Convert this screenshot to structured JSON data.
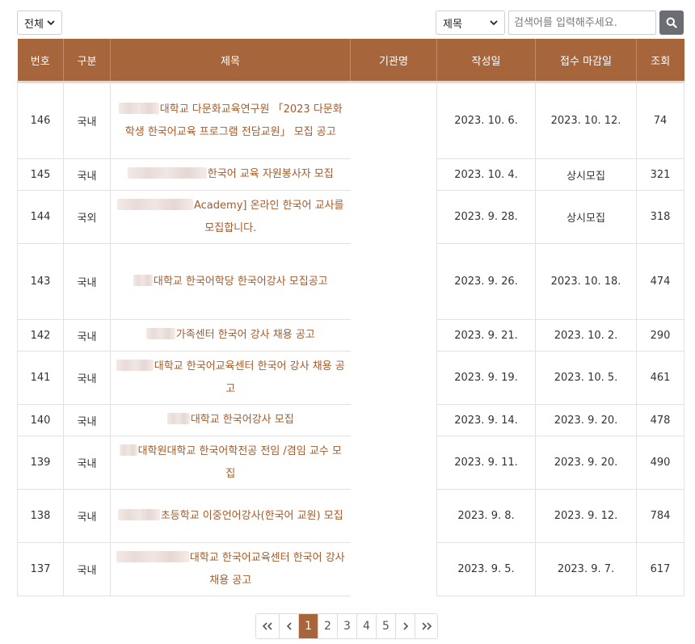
{
  "filters": {
    "category_selected": "전체",
    "field_selected": "제목",
    "search_placeholder": "검색어를 입력해주세요."
  },
  "table": {
    "headers": [
      "번호",
      "구분",
      "제목",
      "기관명",
      "작성일",
      "접수 마감일",
      "조회"
    ],
    "rows": [
      {
        "no": "146",
        "type": "국내",
        "title": "대학교 다문화교육연구원 「2023 다문화학생 한국어교육 프로그램 전담교원」 모집 공고",
        "date": "2023. 10. 6.",
        "deadline": "2023. 10. 12.",
        "views": "74"
      },
      {
        "no": "145",
        "type": "국내",
        "title": "한국어 교육 자원봉사자 모집",
        "date": "2023. 10. 4.",
        "deadline": "상시모집",
        "views": "321"
      },
      {
        "no": "144",
        "type": "국외",
        "title": "Academy] 온라인 한국어 교사를 모집합니다.",
        "date": "2023. 9. 28.",
        "deadline": "상시모집",
        "views": "318"
      },
      {
        "no": "143",
        "type": "국내",
        "title": "대학교 한국어학당 한국어강사 모집공고",
        "date": "2023. 9. 26.",
        "deadline": "2023. 10. 18.",
        "views": "474"
      },
      {
        "no": "142",
        "type": "국내",
        "title": "가족센터 한국어 강사 채용 공고",
        "date": "2023. 9. 21.",
        "deadline": "2023. 10. 2.",
        "views": "290"
      },
      {
        "no": "141",
        "type": "국내",
        "title": "대학교 한국어교육센터 한국어 강사 채용 공고",
        "date": "2023. 9. 19.",
        "deadline": "2023. 10. 5.",
        "views": "461"
      },
      {
        "no": "140",
        "type": "국내",
        "title": "대학교 한국어강사 모집",
        "date": "2023. 9. 14.",
        "deadline": "2023. 9. 20.",
        "views": "478"
      },
      {
        "no": "139",
        "type": "국내",
        "title": "대학원대학교 한국어학전공 전임 /겸임 교수 모집",
        "date": "2023. 9. 11.",
        "deadline": "2023. 9. 20.",
        "views": "490"
      },
      {
        "no": "138",
        "type": "국내",
        "title": "초등학교 이중언어강사(한국어 교원) 모집",
        "date": "2023. 9. 8.",
        "deadline": "2023. 9. 12.",
        "views": "784"
      },
      {
        "no": "137",
        "type": "국내",
        "title": "대학교 한국어교육센터 한국어 강사 채용 공고",
        "date": "2023. 9. 5.",
        "deadline": "2023. 9. 7.",
        "views": "617"
      }
    ]
  },
  "pagination": {
    "first_icon": "double-chevron-left-icon",
    "prev_icon": "chevron-left-icon",
    "pages": [
      "1",
      "2",
      "3",
      "4",
      "5"
    ],
    "current": "1",
    "next_icon": "chevron-right-icon",
    "last_icon": "double-chevron-right-icon"
  },
  "colors": {
    "header_bg": "#a6653b",
    "title_link": "#a65a2a",
    "search_button": "#6a6e73",
    "active_page": "#a6653b"
  }
}
